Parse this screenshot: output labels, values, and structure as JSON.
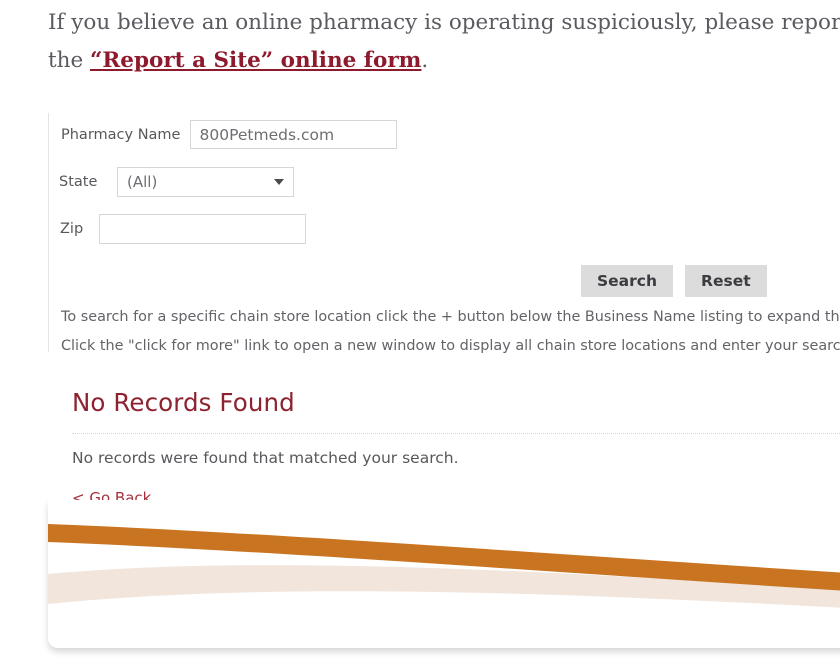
{
  "intro": {
    "text_before": "If you believe an online pharmacy is operating  suspiciously, please report it by submitting the ",
    "link_text": "“Report a Site” online form",
    "text_after": "."
  },
  "search_form": {
    "pharmacy_name": {
      "label": "Pharmacy Name",
      "value": "800Petmeds.com",
      "placeholder": ""
    },
    "state": {
      "label": "State",
      "selected": "(All)",
      "arrow_icon": "chevron-down-icon"
    },
    "zip": {
      "label": "Zip",
      "value": "",
      "placeholder": ""
    },
    "search_button": "Search",
    "reset_button": "Reset",
    "helper_line_1": "To search for a specific chain store location click the + button below the Business Name listing to expand the list.",
    "helper_line_2": "Click the \"click for more\" link to open a new window to display all chain store locations and enter your search criteria."
  },
  "results": {
    "title": "No Records Found",
    "message": "No records were found that matched your search.",
    "go_back_link": "< Go Back"
  },
  "colors": {
    "link_red": "#8d1b2d",
    "heading_red": "#8d2231",
    "go_back_red": "#a5303a",
    "body_gray": "#5a5a60",
    "label_gray": "#58585c",
    "button_bg": "#dcdcdc",
    "input_border": "#d6d6d6",
    "wave_orange": "#c97420",
    "wave_peach": "#f2e5dc",
    "divider_dotted": "#d9d4d4"
  }
}
